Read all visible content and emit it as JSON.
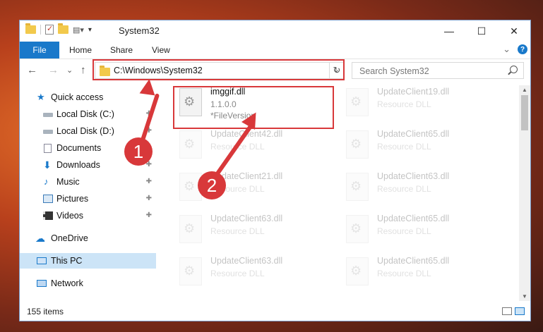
{
  "window": {
    "title": "System32",
    "minimize": "—",
    "maximize": "☐",
    "close": "✕"
  },
  "ribbon": {
    "tabs": [
      "File",
      "Home",
      "Share",
      "View"
    ],
    "collapse": "⌄",
    "help": "?"
  },
  "nav": {
    "back": "←",
    "forward": "→",
    "recent": "⌄",
    "up": "↑",
    "address": "C:\\Windows\\System32",
    "address_dropdown": "⌄",
    "refresh": "↻",
    "search_placeholder": "Search System32"
  },
  "sidebar": {
    "items": [
      {
        "label": "Quick access",
        "icon": "star-icon",
        "pinned": false
      },
      {
        "label": "Local Disk (C:)",
        "icon": "drive-icon",
        "pinned": true
      },
      {
        "label": "Local Disk (D:)",
        "icon": "drive-icon",
        "pinned": true
      },
      {
        "label": "Documents",
        "icon": "documents-icon",
        "pinned": true
      },
      {
        "label": "Downloads",
        "icon": "download-icon",
        "pinned": true
      },
      {
        "label": "Music",
        "icon": "music-icon",
        "pinned": true
      },
      {
        "label": "Pictures",
        "icon": "pictures-icon",
        "pinned": true
      },
      {
        "label": "Videos",
        "icon": "videos-icon",
        "pinned": true
      },
      {
        "label": "OneDrive",
        "icon": "cloud-icon",
        "pinned": false
      },
      {
        "label": "This PC",
        "icon": "computer-icon",
        "pinned": false,
        "selected": true
      },
      {
        "label": "Network",
        "icon": "network-icon",
        "pinned": false
      }
    ],
    "pin_glyph": "📌"
  },
  "files": [
    {
      "name": "imggif.dll",
      "line2": "1.1.0.0",
      "line3": "*FileVersion",
      "highlight": true
    },
    {
      "name": "UpdateClient19.dll",
      "line2": "Resource DLL"
    },
    {
      "name": "UpdateClient42.dll",
      "line2": "Resource DLL"
    },
    {
      "name": "UpdateClient65.dll",
      "line2": "Resource DLL"
    },
    {
      "name": "UpdateClient21.dll",
      "line2": "Resource DLL"
    },
    {
      "name": "UpdateClient63.dll",
      "line2": "Resource DLL"
    },
    {
      "name": "UpdateClient63.dll",
      "line2": "Resource DLL"
    },
    {
      "name": "UpdateClient65.dll",
      "line2": "Resource DLL"
    },
    {
      "name": "UpdateClient63.dll",
      "line2": "Resource DLL"
    },
    {
      "name": "UpdateClient65.dll",
      "line2": "Resource DLL"
    }
  ],
  "status": {
    "item_count": "155 items"
  },
  "callouts": [
    "1",
    "2"
  ],
  "colors": {
    "accent": "#1979ca",
    "highlight": "#d8383a",
    "selected": "#cce4f7"
  }
}
